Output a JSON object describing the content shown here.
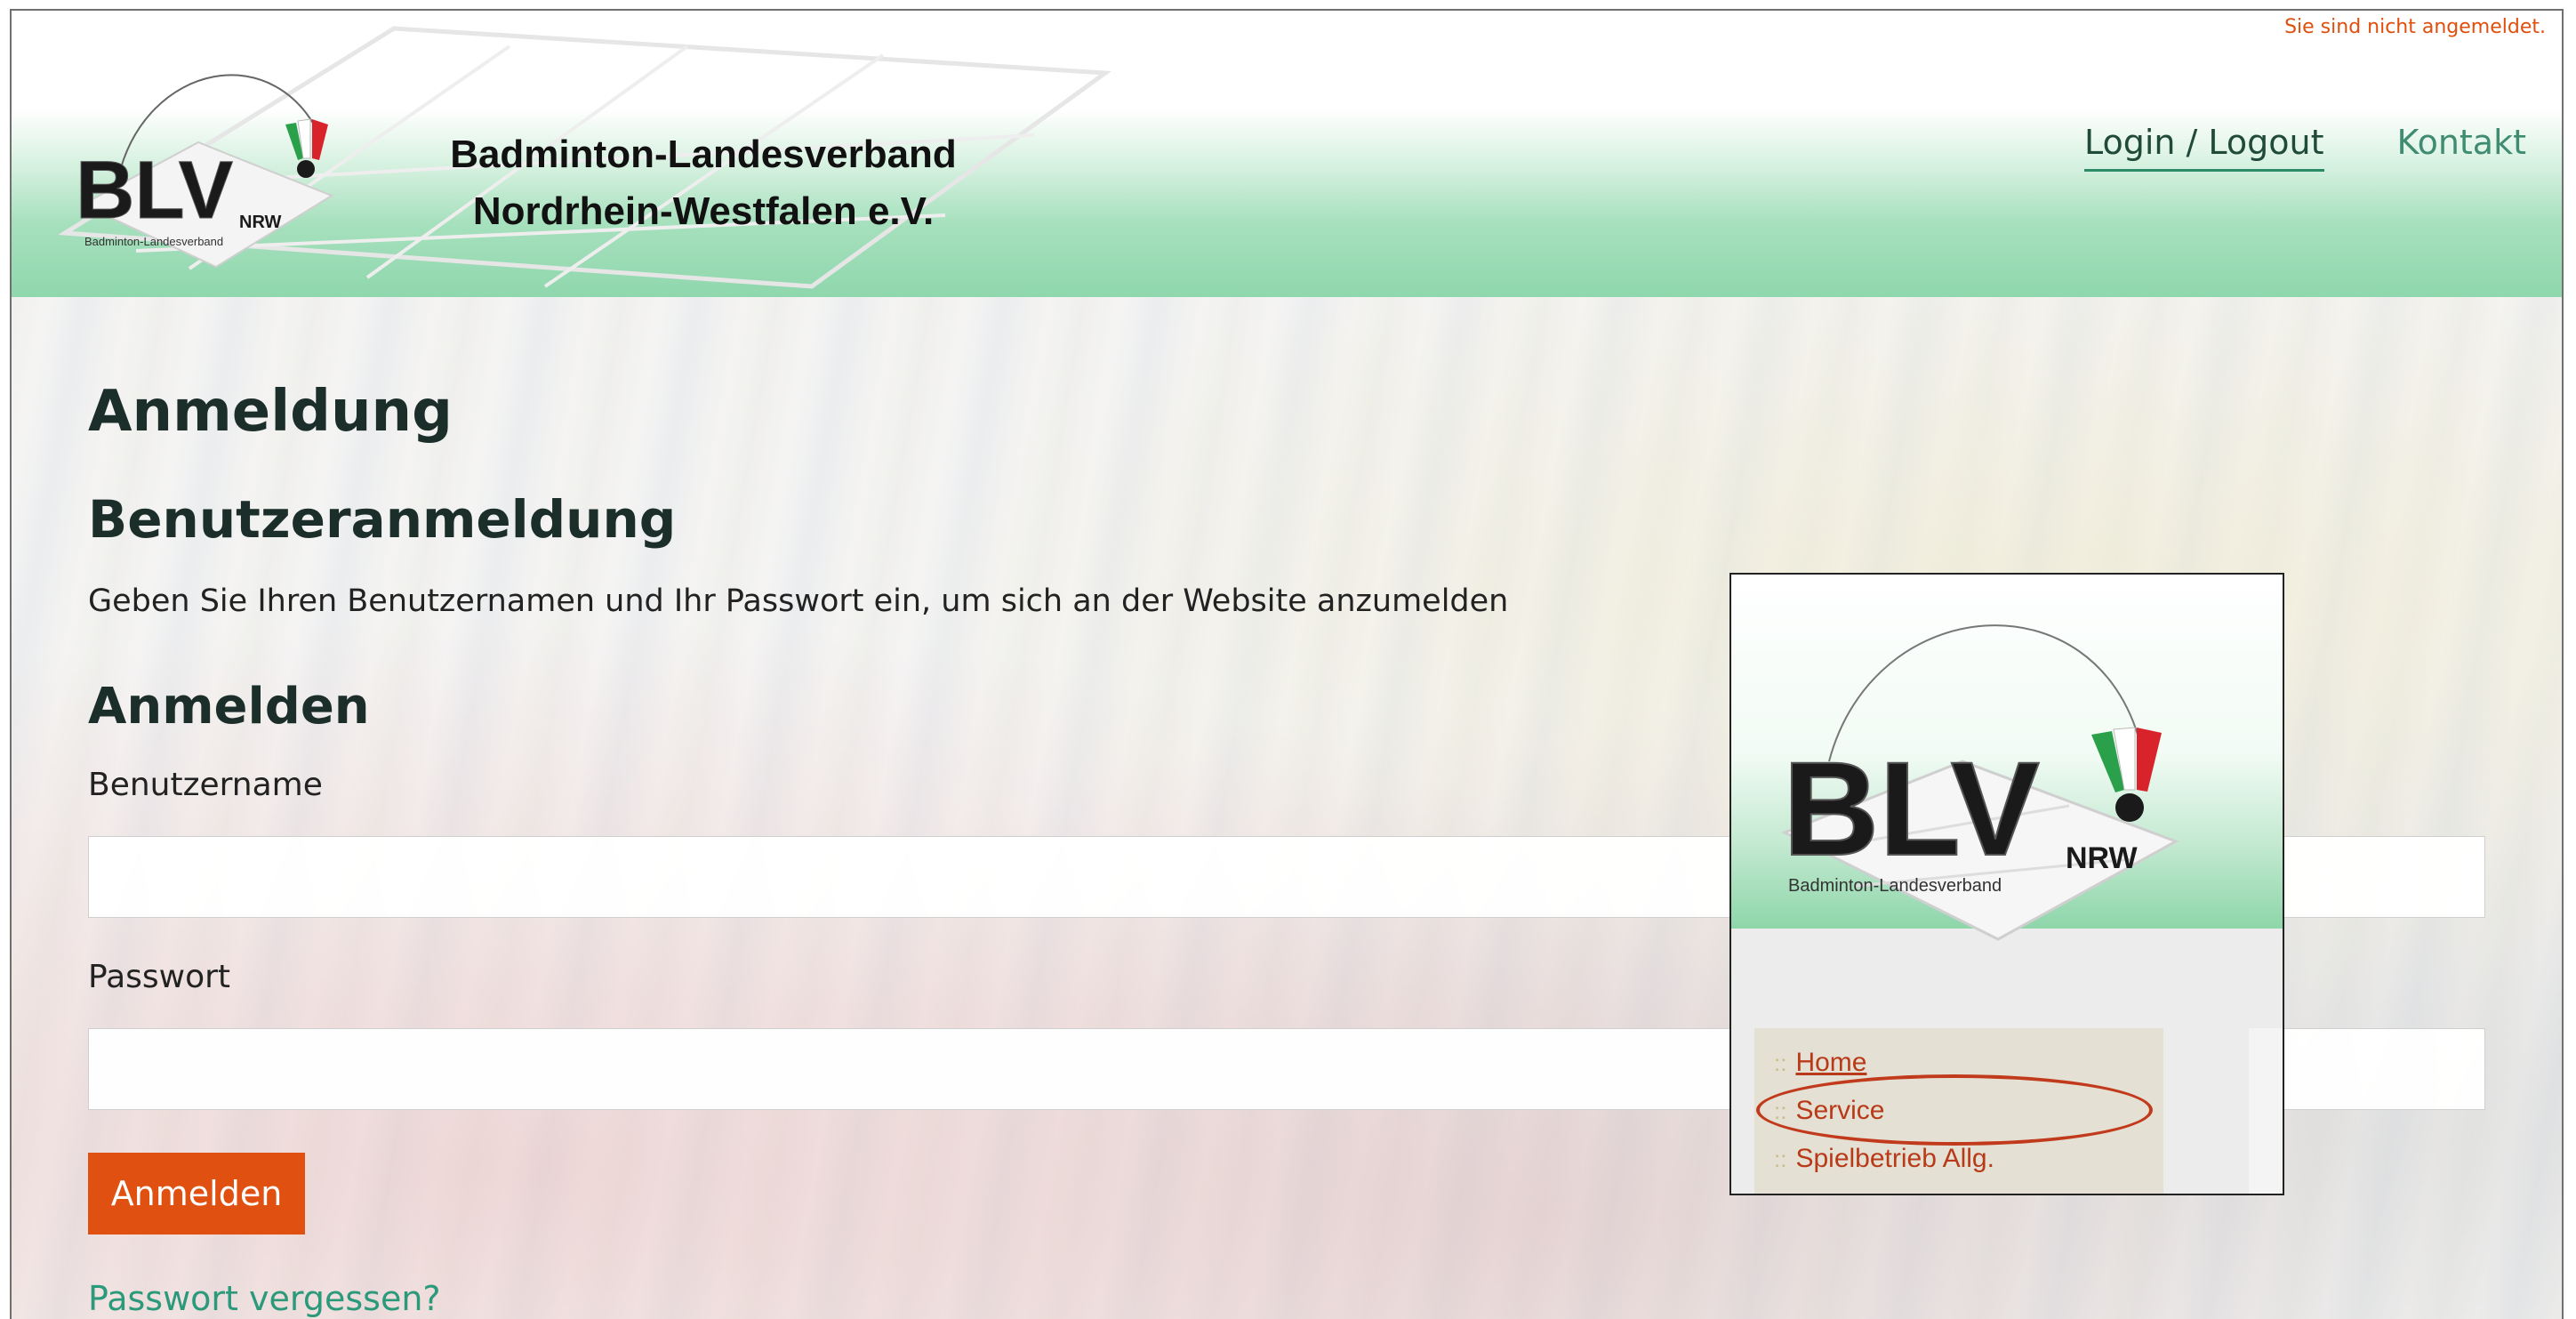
{
  "header": {
    "status_text": "Sie sind nicht angemeldet.",
    "logo_text": "BLV",
    "logo_badge": "NRW",
    "logo_subtitle": "Badminton-Landesverband",
    "brand_line1": "Badminton-Landesverband",
    "brand_line2": "Nordrhein-Westfalen e.V.",
    "nav": {
      "login_logout": "Login / Logout",
      "kontakt": "Kontakt"
    }
  },
  "main": {
    "page_title": "Anmeldung",
    "section_title": "Benutzeranmeldung",
    "intro": "Geben Sie Ihren Benutzernamen und Ihr Passwort ein, um sich an der Website anzumelden",
    "form_title": "Anmelden",
    "username_label": "Benutzername",
    "username_value": "",
    "password_label": "Passwort",
    "password_value": "",
    "submit_label": "Anmelden",
    "forgot_link": "Passwort vergessen?"
  },
  "inset": {
    "logo_text": "BLV",
    "logo_badge": "NRW",
    "logo_subtitle": "Badminton-Landesverband",
    "menu_items": [
      {
        "label": "Home"
      },
      {
        "label": "Service"
      },
      {
        "label": "Spielbetrieb Allg."
      }
    ],
    "highlighted_item": "Service"
  },
  "colors": {
    "accent_orange": "#e05010",
    "header_green": "#8fd7ad",
    "link_teal": "#2b9a7a",
    "highlight_red": "#c23a1c"
  }
}
